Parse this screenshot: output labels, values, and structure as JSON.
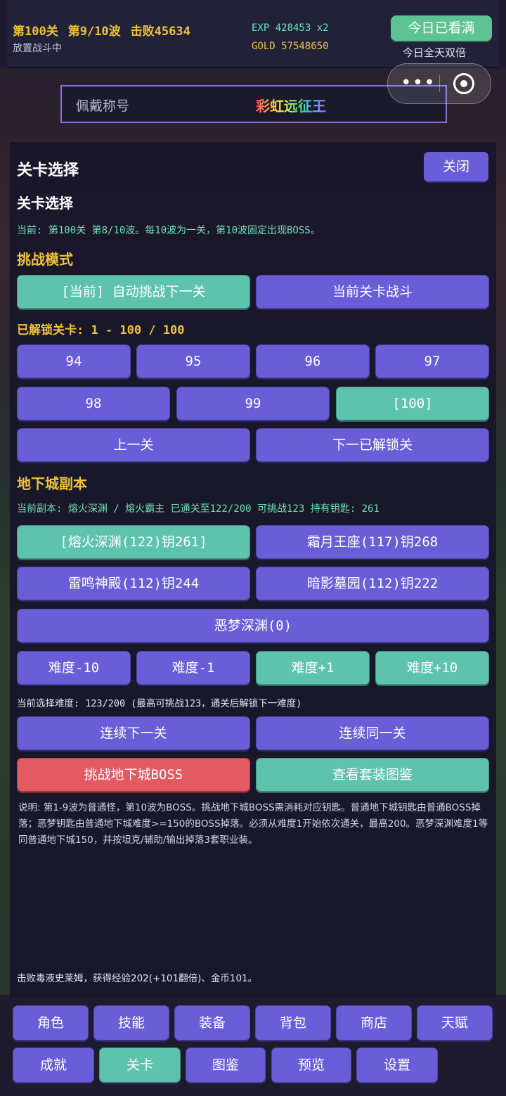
{
  "hud": {
    "level": "第100关",
    "wave": "第9/10波",
    "defeated": "击败45634",
    "status": "放置战斗中",
    "exp": "EXP 428453 x2",
    "gold": "GOLD 57548650",
    "watch_button": "今日已看满",
    "double_label": "今日全天双倍"
  },
  "title_bar": {
    "label": "佩戴称号",
    "value": "彩虹远征王"
  },
  "panel": {
    "title": "关卡选择",
    "close": "关闭",
    "section_title": "关卡选择",
    "current_info": "当前: 第100关 第8/10波。每10波为一关，第10波固定出现BOSS。",
    "mode_title": "挑战模式",
    "mode_buttons": [
      "[当前] 自动挑战下一关",
      "当前关卡战斗"
    ],
    "unlocked": "已解锁关卡: 1 - 100 / 100",
    "levels": [
      "94",
      "95",
      "96",
      "97",
      "98",
      "99",
      "[100]"
    ],
    "prev": "上一关",
    "next": "下一已解锁关",
    "dungeon_title": "地下城副本",
    "dungeon_info": "当前副本: 熔火深渊 / 熔火霸主  已通关至122/200  可挑战123  持有钥匙: 261",
    "dungeons": [
      "[熔火深渊(122)钥261]",
      "霜月王座(117)钥268",
      "雷鸣神殿(112)钥244",
      "暗影墓园(112)钥222",
      "恶梦深渊(0)"
    ],
    "difficulty_buttons": [
      "难度-10",
      "难度-1",
      "难度+1",
      "难度+10"
    ],
    "difficulty_info": "当前选择难度: 123/200 (最高可挑战123，通关后解锁下一难度)",
    "next_level": "连续下一关",
    "same_level": "连续同一关",
    "boss": "挑战地下城BOSS",
    "collection": "查看套装图鉴",
    "description": "说明: 第1-9波为普通怪，第10波为BOSS。挑战地下城BOSS需消耗对应钥匙。普通地下城钥匙由普通BOSS掉落；恶梦钥匙由普通地下城难度>=150的BOSS掉落。必须从难度1开始依次通关，最高200。恶梦深渊难度1等同普通地下城150，并按坦克/辅助/输出掉落3套职业装。"
  },
  "log": [
    "击败毒液史莱姆，获得经验202(+101翻倍)、金币101。"
  ],
  "nav": [
    "角色",
    "技能",
    "装备",
    "背包",
    "商店",
    "天赋",
    "成就",
    "关卡",
    "图鉴",
    "预览",
    "设置"
  ],
  "colors": {
    "purple": "#6a5ed8",
    "teal": "#5ec3ad",
    "red": "#e45a62",
    "yellow": "#f0c23a",
    "green_text": "#6fe0b4"
  }
}
